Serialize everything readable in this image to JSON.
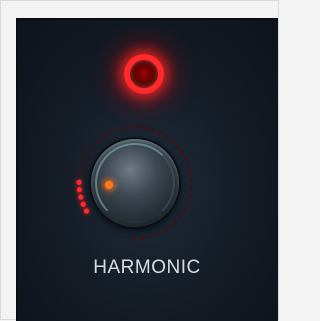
{
  "control": {
    "label": "HARMONIC",
    "value_fraction": 0.12,
    "led_state": "on",
    "led_color": "#ff2a2a",
    "active_dot_color": "#ff2a2a",
    "inactive_dot_color": "#4a0d0d",
    "indicator_color": "#ff7a1a"
  },
  "icons": {
    "led": "status-led-icon",
    "knob": "rotary-knob"
  }
}
